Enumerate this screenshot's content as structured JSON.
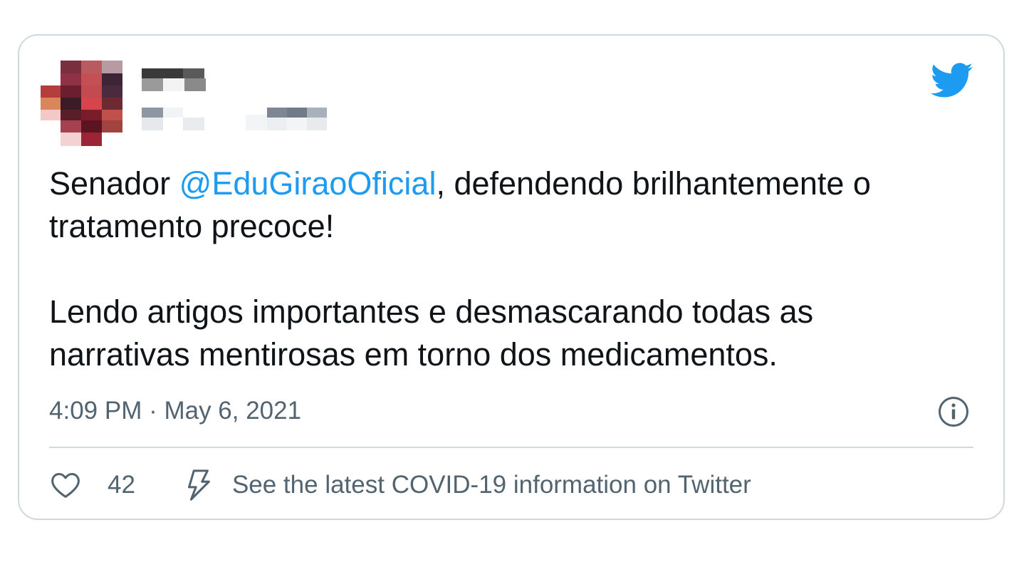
{
  "tweet": {
    "text_line1_prefix": "Senador ",
    "mention": "@EduGiraoOficial",
    "text_line1_suffix": ", defendendo brilhantemente o\ntratamento precoce!\n\nLendo artigos importantes e desmascarando todas as\nnarrativas mentirosas em torno dos medicamentos.",
    "timestamp": "4:09 PM · May 6, 2021",
    "like_count": "42",
    "covid_link": "See the latest COVID-19 information on Twitter"
  },
  "colors": {
    "link": "#1d9bf0",
    "text": "#0f1419",
    "secondary": "#536471",
    "border": "#cfd9de"
  },
  "icons": [
    "twitter-bird-icon",
    "info-icon",
    "heart-icon",
    "lightning-icon"
  ]
}
